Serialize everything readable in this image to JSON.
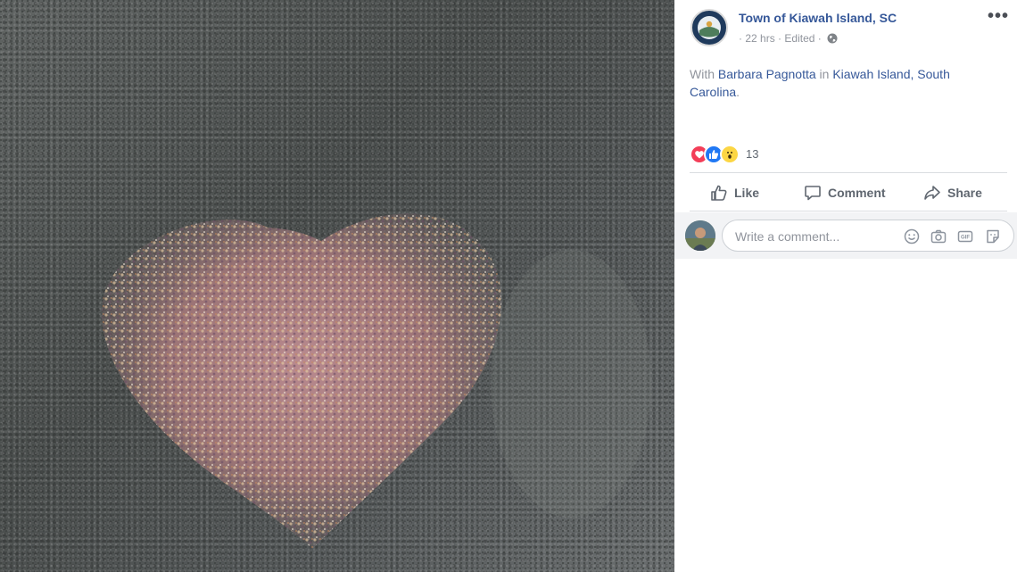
{
  "post": {
    "page_name": "Town of Kiawah Island, SC",
    "dot": "·",
    "time": "22 hrs",
    "separator": "·",
    "edited": "Edited",
    "separator2": "·",
    "privacy_icon": "globe-icon",
    "more_label": "•••",
    "with_word": "With",
    "tagged_person": "Barbara Pagnotta",
    "in_word": "in",
    "location": "Kiawah Island, South Carolina",
    "period": "."
  },
  "reactions": {
    "icons": [
      "love-icon",
      "like-icon",
      "wow-icon"
    ],
    "count": "13"
  },
  "actions": {
    "like_label": "Like",
    "comment_label": "Comment",
    "share_label": "Share"
  },
  "comment": {
    "placeholder": "Write a comment...",
    "icons": [
      "emoji-icon",
      "camera-icon",
      "gif-icon",
      "sticker-icon"
    ]
  },
  "photo": {
    "icon": "heart-shell-photo"
  },
  "colors": {
    "link": "#365899",
    "meta": "#90949c",
    "action_text": "#606770",
    "love": "#f33e58",
    "like": "#2078f4",
    "wow": "#fcd644"
  }
}
